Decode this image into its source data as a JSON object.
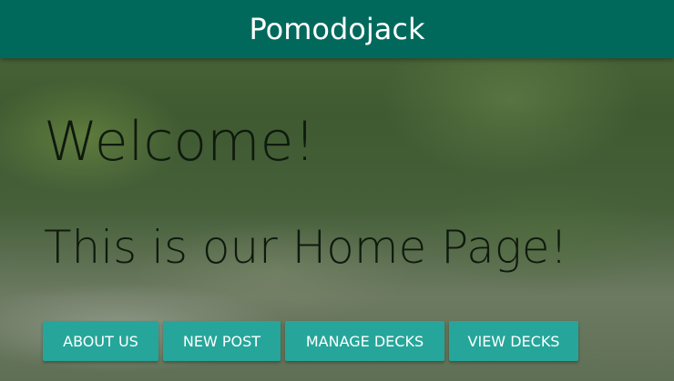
{
  "header": {
    "brand": "Pomodojack",
    "color": "#00695c"
  },
  "main": {
    "heading": "Welcome!",
    "subheading": "This is our Home Page!"
  },
  "buttons": {
    "about": "ABOUT US",
    "new_post": "NEW POST",
    "manage_decks": "MANAGE DECKS",
    "view_decks": "VIEW DECKS",
    "color": "#26a69a"
  }
}
